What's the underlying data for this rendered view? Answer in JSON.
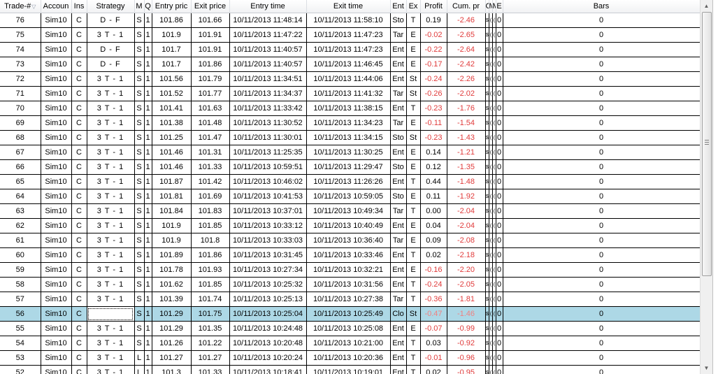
{
  "columns": [
    "Trade-#",
    "Accoun",
    "Ins",
    "Strategy",
    "M",
    "Q",
    "Entry pric",
    "Exit price",
    "Entry time",
    "Exit time",
    "Ent",
    "Ex",
    "Profit",
    "Cum. pr",
    "C",
    "M",
    "M",
    "E",
    "Bars"
  ],
  "sort_indicator": "▽",
  "rows": [
    {
      "trade": "76",
      "account": "Sim10",
      "ins": "C",
      "strategy": "D - F",
      "m": "S",
      "q": "1",
      "entry_price": "101.86",
      "exit_price": "101.66",
      "entry_time": "10/11/2013 11:48:14",
      "exit_time": "10/11/2013 11:58:10",
      "ent": "Sto",
      "ex": "T",
      "profit": "0.19",
      "cum": "-2.46",
      "c": "$",
      "m1": "(",
      "m2": "(",
      "e": "0",
      "bars": "0"
    },
    {
      "trade": "75",
      "account": "Sim10",
      "ins": "C",
      "strategy": "3 T - 1",
      "m": "S",
      "q": "1",
      "entry_price": "101.9",
      "exit_price": "101.91",
      "entry_time": "10/11/2013 11:47:22",
      "exit_time": "10/11/2013 11:47:23",
      "ent": "Tar",
      "ex": "E",
      "profit": "-0.02",
      "cum": "-2.65",
      "c": "$",
      "m1": "(",
      "m2": "(",
      "e": "0",
      "bars": "0"
    },
    {
      "trade": "74",
      "account": "Sim10",
      "ins": "C",
      "strategy": "D - F",
      "m": "S",
      "q": "1",
      "entry_price": "101.7",
      "exit_price": "101.91",
      "entry_time": "10/11/2013 11:40:57",
      "exit_time": "10/11/2013 11:47:23",
      "ent": "Ent",
      "ex": "E",
      "profit": "-0.22",
      "cum": "-2.64",
      "c": "$",
      "m1": "(",
      "m2": "(",
      "e": "0",
      "bars": "0"
    },
    {
      "trade": "73",
      "account": "Sim10",
      "ins": "C",
      "strategy": "D - F",
      "m": "S",
      "q": "1",
      "entry_price": "101.7",
      "exit_price": "101.86",
      "entry_time": "10/11/2013 11:40:57",
      "exit_time": "10/11/2013 11:46:45",
      "ent": "Ent",
      "ex": "E",
      "profit": "-0.17",
      "cum": "-2.42",
      "c": "$",
      "m1": "(",
      "m2": "(",
      "e": "0",
      "bars": "0"
    },
    {
      "trade": "72",
      "account": "Sim10",
      "ins": "C",
      "strategy": "3 T - 1",
      "m": "S",
      "q": "1",
      "entry_price": "101.56",
      "exit_price": "101.79",
      "entry_time": "10/11/2013 11:34:51",
      "exit_time": "10/11/2013 11:44:06",
      "ent": "Ent",
      "ex": "St",
      "profit": "-0.24",
      "cum": "-2.26",
      "c": "$",
      "m1": "(",
      "m2": "(",
      "e": "0",
      "bars": "0"
    },
    {
      "trade": "71",
      "account": "Sim10",
      "ins": "C",
      "strategy": "3 T - 1",
      "m": "S",
      "q": "1",
      "entry_price": "101.52",
      "exit_price": "101.77",
      "entry_time": "10/11/2013 11:34:37",
      "exit_time": "10/11/2013 11:41:32",
      "ent": "Tar",
      "ex": "St",
      "profit": "-0.26",
      "cum": "-2.02",
      "c": "$",
      "m1": "(",
      "m2": "(",
      "e": "0",
      "bars": "0"
    },
    {
      "trade": "70",
      "account": "Sim10",
      "ins": "C",
      "strategy": "3 T - 1",
      "m": "S",
      "q": "1",
      "entry_price": "101.41",
      "exit_price": "101.63",
      "entry_time": "10/11/2013 11:33:42",
      "exit_time": "10/11/2013 11:38:15",
      "ent": "Ent",
      "ex": "T",
      "profit": "-0.23",
      "cum": "-1.76",
      "c": "$",
      "m1": "(",
      "m2": "(",
      "e": "0",
      "bars": "0"
    },
    {
      "trade": "69",
      "account": "Sim10",
      "ins": "C",
      "strategy": "3 T - 1",
      "m": "S",
      "q": "1",
      "entry_price": "101.38",
      "exit_price": "101.48",
      "entry_time": "10/11/2013 11:30:52",
      "exit_time": "10/11/2013 11:34:23",
      "ent": "Tar",
      "ex": "E",
      "profit": "-0.11",
      "cum": "-1.54",
      "c": "$",
      "m1": "(",
      "m2": "(",
      "e": "0",
      "bars": "0"
    },
    {
      "trade": "68",
      "account": "Sim10",
      "ins": "C",
      "strategy": "3 T - 1",
      "m": "S",
      "q": "1",
      "entry_price": "101.25",
      "exit_price": "101.47",
      "entry_time": "10/11/2013 11:30:01",
      "exit_time": "10/11/2013 11:34:15",
      "ent": "Sto",
      "ex": "St",
      "profit": "-0.23",
      "cum": "-1.43",
      "c": "$",
      "m1": "(",
      "m2": "(",
      "e": "0",
      "bars": "0"
    },
    {
      "trade": "67",
      "account": "Sim10",
      "ins": "C",
      "strategy": "3 T - 1",
      "m": "S",
      "q": "1",
      "entry_price": "101.46",
      "exit_price": "101.31",
      "entry_time": "10/11/2013 11:25:35",
      "exit_time": "10/11/2013 11:30:25",
      "ent": "Ent",
      "ex": "E",
      "profit": "0.14",
      "cum": "-1.21",
      "c": "$",
      "m1": "(",
      "m2": "(",
      "e": "0",
      "bars": "0"
    },
    {
      "trade": "66",
      "account": "Sim10",
      "ins": "C",
      "strategy": "3 T - 1",
      "m": "S",
      "q": "1",
      "entry_price": "101.46",
      "exit_price": "101.33",
      "entry_time": "10/11/2013 10:59:51",
      "exit_time": "10/11/2013 11:29:47",
      "ent": "Sto",
      "ex": "E",
      "profit": "0.12",
      "cum": "-1.35",
      "c": "$",
      "m1": "(",
      "m2": "(",
      "e": "0",
      "bars": "0"
    },
    {
      "trade": "65",
      "account": "Sim10",
      "ins": "C",
      "strategy": "3 T - 1",
      "m": "S",
      "q": "1",
      "entry_price": "101.87",
      "exit_price": "101.42",
      "entry_time": "10/11/2013 10:46:02",
      "exit_time": "10/11/2013 11:26:26",
      "ent": "Ent",
      "ex": "T",
      "profit": "0.44",
      "cum": "-1.48",
      "c": "$",
      "m1": "(",
      "m2": "(",
      "e": "0",
      "bars": "0"
    },
    {
      "trade": "64",
      "account": "Sim10",
      "ins": "C",
      "strategy": "3 T - 1",
      "m": "S",
      "q": "1",
      "entry_price": "101.81",
      "exit_price": "101.69",
      "entry_time": "10/11/2013 10:41:53",
      "exit_time": "10/11/2013 10:59:05",
      "ent": "Sto",
      "ex": "E",
      "profit": "0.11",
      "cum": "-1.92",
      "c": "$",
      "m1": "(",
      "m2": "(",
      "e": "0",
      "bars": "0"
    },
    {
      "trade": "63",
      "account": "Sim10",
      "ins": "C",
      "strategy": "3 T - 1",
      "m": "S",
      "q": "1",
      "entry_price": "101.84",
      "exit_price": "101.83",
      "entry_time": "10/11/2013 10:37:01",
      "exit_time": "10/11/2013 10:49:34",
      "ent": "Tar",
      "ex": "T",
      "profit": "0.00",
      "cum": "-2.04",
      "c": "$",
      "m1": "(",
      "m2": "(",
      "e": "0",
      "bars": "0"
    },
    {
      "trade": "62",
      "account": "Sim10",
      "ins": "C",
      "strategy": "3 T - 1",
      "m": "S",
      "q": "1",
      "entry_price": "101.9",
      "exit_price": "101.85",
      "entry_time": "10/11/2013 10:33:12",
      "exit_time": "10/11/2013 10:40:49",
      "ent": "Ent",
      "ex": "E",
      "profit": "0.04",
      "cum": "-2.04",
      "c": "$",
      "m1": "(",
      "m2": "(",
      "e": "0",
      "bars": "0"
    },
    {
      "trade": "61",
      "account": "Sim10",
      "ins": "C",
      "strategy": "3 T - 1",
      "m": "S",
      "q": "1",
      "entry_price": "101.9",
      "exit_price": "101.8",
      "entry_time": "10/11/2013 10:33:03",
      "exit_time": "10/11/2013 10:36:40",
      "ent": "Tar",
      "ex": "E",
      "profit": "0.09",
      "cum": "-2.08",
      "c": "$",
      "m1": "(",
      "m2": "(",
      "e": "0",
      "bars": "0"
    },
    {
      "trade": "60",
      "account": "Sim10",
      "ins": "C",
      "strategy": "3 T - 1",
      "m": "S",
      "q": "1",
      "entry_price": "101.89",
      "exit_price": "101.86",
      "entry_time": "10/11/2013 10:31:45",
      "exit_time": "10/11/2013 10:33:46",
      "ent": "Ent",
      "ex": "T",
      "profit": "0.02",
      "cum": "-2.18",
      "c": "$",
      "m1": "(",
      "m2": "(",
      "e": "0",
      "bars": "0"
    },
    {
      "trade": "59",
      "account": "Sim10",
      "ins": "C",
      "strategy": "3 T - 1",
      "m": "S",
      "q": "1",
      "entry_price": "101.78",
      "exit_price": "101.93",
      "entry_time": "10/11/2013 10:27:34",
      "exit_time": "10/11/2013 10:32:21",
      "ent": "Ent",
      "ex": "E",
      "profit": "-0.16",
      "cum": "-2.20",
      "c": "$",
      "m1": "(",
      "m2": "(",
      "e": "0",
      "bars": "0"
    },
    {
      "trade": "58",
      "account": "Sim10",
      "ins": "C",
      "strategy": "3 T - 1",
      "m": "S",
      "q": "1",
      "entry_price": "101.62",
      "exit_price": "101.85",
      "entry_time": "10/11/2013 10:25:32",
      "exit_time": "10/11/2013 10:31:56",
      "ent": "Ent",
      "ex": "T",
      "profit": "-0.24",
      "cum": "-2.05",
      "c": "$",
      "m1": "(",
      "m2": "(",
      "e": "0",
      "bars": "0"
    },
    {
      "trade": "57",
      "account": "Sim10",
      "ins": "C",
      "strategy": "3 T - 1",
      "m": "S",
      "q": "1",
      "entry_price": "101.39",
      "exit_price": "101.74",
      "entry_time": "10/11/2013 10:25:13",
      "exit_time": "10/11/2013 10:27:38",
      "ent": "Tar",
      "ex": "T",
      "profit": "-0.36",
      "cum": "-1.81",
      "c": "$",
      "m1": "(",
      "m2": "(",
      "e": "0",
      "bars": "0"
    },
    {
      "trade": "56",
      "account": "Sim10",
      "ins": "C",
      "strategy": "",
      "m": "S",
      "q": "1",
      "entry_price": "101.29",
      "exit_price": "101.75",
      "entry_time": "10/11/2013 10:25:04",
      "exit_time": "10/11/2013 10:25:49",
      "ent": "Clo",
      "ex": "St",
      "profit": "-0.47",
      "cum": "-1.46",
      "c": "$",
      "m1": "(",
      "m2": "(",
      "e": "0",
      "bars": "0",
      "selected": true
    },
    {
      "trade": "55",
      "account": "Sim10",
      "ins": "C",
      "strategy": "3 T - 1",
      "m": "S",
      "q": "1",
      "entry_price": "101.29",
      "exit_price": "101.35",
      "entry_time": "10/11/2013 10:24:48",
      "exit_time": "10/11/2013 10:25:08",
      "ent": "Ent",
      "ex": "E",
      "profit": "-0.07",
      "cum": "-0.99",
      "c": "$",
      "m1": "(",
      "m2": "(",
      "e": "0",
      "bars": "0"
    },
    {
      "trade": "54",
      "account": "Sim10",
      "ins": "C",
      "strategy": "3 T - 1",
      "m": "S",
      "q": "1",
      "entry_price": "101.26",
      "exit_price": "101.22",
      "entry_time": "10/11/2013 10:20:48",
      "exit_time": "10/11/2013 10:21:00",
      "ent": "Ent",
      "ex": "T",
      "profit": "0.03",
      "cum": "-0.92",
      "c": "$",
      "m1": "(",
      "m2": "(",
      "e": "0",
      "bars": "0"
    },
    {
      "trade": "53",
      "account": "Sim10",
      "ins": "C",
      "strategy": "3 T - 1",
      "m": "L",
      "q": "1",
      "entry_price": "101.27",
      "exit_price": "101.27",
      "entry_time": "10/11/2013 10:20:24",
      "exit_time": "10/11/2013 10:20:36",
      "ent": "Ent",
      "ex": "T",
      "profit": "-0.01",
      "cum": "-0.96",
      "c": "$",
      "m1": "(",
      "m2": "(",
      "e": "0",
      "bars": "0"
    },
    {
      "trade": "52",
      "account": "Sim10",
      "ins": "C",
      "strategy": "3 T - 1",
      "m": "L",
      "q": "1",
      "entry_price": "101.3",
      "exit_price": "101.33",
      "entry_time": "10/11/2013 10:18:41",
      "exit_time": "10/11/2013 10:19:01",
      "ent": "Ent",
      "ex": "T",
      "profit": "0.02",
      "cum": "-0.95",
      "c": "$",
      "m1": "(",
      "m2": "(",
      "e": "0",
      "bars": "0"
    }
  ],
  "colors": {
    "header_bg": "#f1f2f4",
    "selected_row": "#add8e6",
    "negative": "#e03b3b",
    "grid_line": "#000000"
  },
  "scrollbar": {
    "up_icon": "scroll-up-arrow-icon",
    "down_icon": "scroll-down-arrow-icon",
    "position_fraction": 0.0
  }
}
